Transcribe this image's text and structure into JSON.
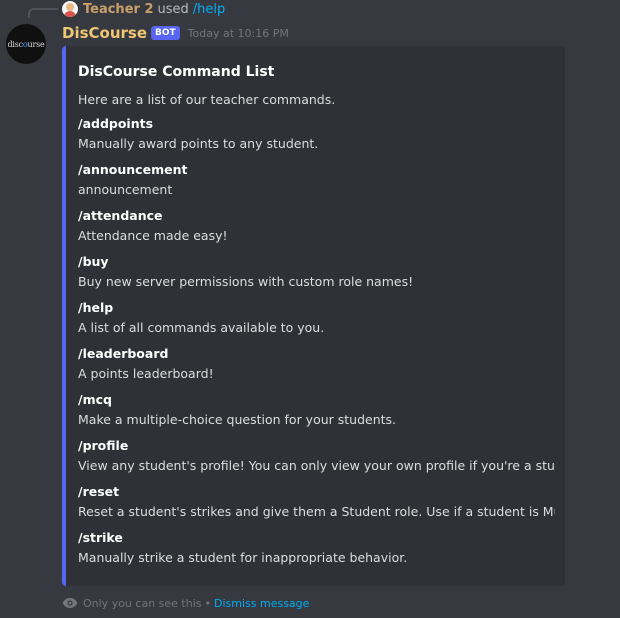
{
  "reply": {
    "author": "Teacher 2",
    "used_text": "used",
    "command": "/help"
  },
  "message": {
    "avatar_logo": "disc🔵urse",
    "username": "DisCourse",
    "bot_tag": "BOT",
    "timestamp": "Today at 10:16 PM"
  },
  "embed": {
    "accent_color": "#5865f2",
    "title": "DisCourse Command List",
    "description": "Here are a list of our teacher commands.",
    "fields": [
      {
        "name": "/addpoints",
        "value": "Manually award points to any student."
      },
      {
        "name": "/announcement",
        "value": "announcement"
      },
      {
        "name": "/attendance",
        "value": "Attendance made easy!"
      },
      {
        "name": "/buy",
        "value": "Buy new server permissions with custom role names!"
      },
      {
        "name": "/help",
        "value": "A list of all commands available to you."
      },
      {
        "name": "/leaderboard",
        "value": "A points leaderboard!"
      },
      {
        "name": "/mcq",
        "value": "Make a multiple-choice question for your students."
      },
      {
        "name": "/profile",
        "value": "View any student's profile! You can only view your own profile if you're a student."
      },
      {
        "name": "/reset",
        "value": "Reset a student's strikes and give them a Student role. Use if a student is Muted/"
      },
      {
        "name": "/strike",
        "value": "Manually strike a student for inappropriate behavior."
      }
    ]
  },
  "ephemeral": {
    "icon": "eye-icon",
    "notice": "Only you can see this",
    "separator": "•",
    "dismiss_label": "Dismiss message"
  }
}
